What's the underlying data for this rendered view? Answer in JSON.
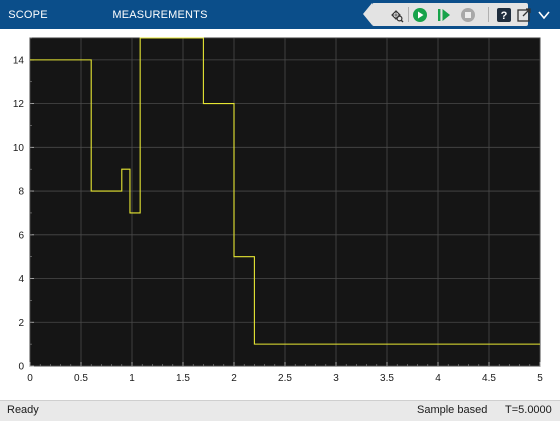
{
  "toolbar": {
    "tabs": [
      {
        "label": "SCOPE"
      },
      {
        "label": "MEASUREMENTS"
      }
    ],
    "buttons": [
      {
        "name": "highlight-block-button",
        "icon": "highlight-block-icon"
      },
      {
        "name": "run-button",
        "icon": "run-icon"
      },
      {
        "name": "step-forward-button",
        "icon": "step-forward-icon"
      },
      {
        "name": "stop-button",
        "icon": "stop-icon"
      },
      {
        "name": "help-button",
        "icon": "help-icon"
      },
      {
        "name": "undock-button",
        "icon": "undock-icon"
      }
    ],
    "colors": {
      "bar": "#0b4e8a",
      "run": "#16a34a",
      "stop": "#9a9a9a"
    }
  },
  "status": {
    "left": "Ready",
    "mode": "Sample based",
    "time": "T=5.0000"
  },
  "chart_data": {
    "type": "line",
    "xlim": [
      0,
      5
    ],
    "ylim": [
      0,
      15
    ],
    "x_ticks": [
      "0",
      "0.5",
      "1",
      "1.5",
      "2",
      "2.5",
      "3",
      "3.5",
      "4",
      "4.5",
      "5"
    ],
    "y_ticks": [
      "0",
      "2",
      "4",
      "6",
      "8",
      "10",
      "12",
      "14"
    ],
    "grid": true,
    "background": "#151515",
    "series": [
      {
        "color": "#e6e633",
        "step": true,
        "x": [
          0,
          0.6,
          0.9,
          0.98,
          1.08,
          1.7,
          2.0,
          2.2,
          5.0
        ],
        "y": [
          14,
          8,
          9,
          7,
          15,
          12,
          5,
          1,
          1
        ]
      }
    ]
  }
}
